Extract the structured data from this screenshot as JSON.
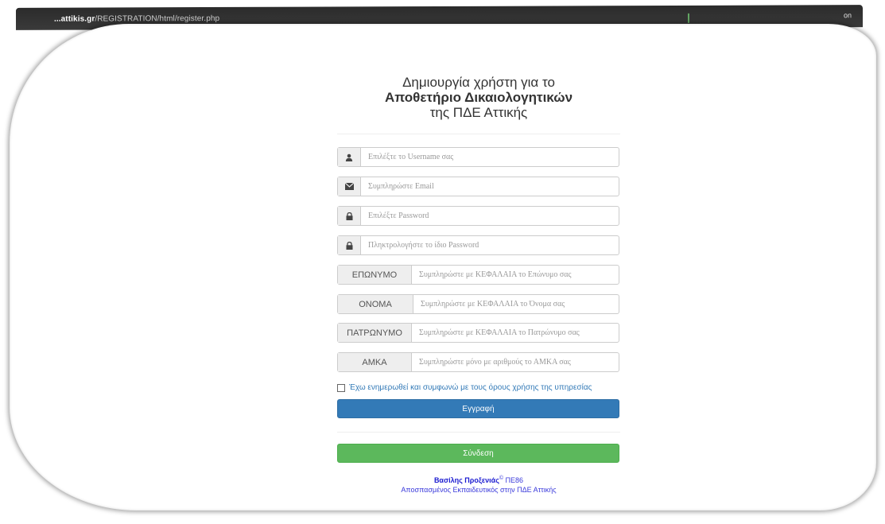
{
  "browser": {
    "url_host": "...attikis.gr",
    "url_path": "/REGISTRATION/html/register.php",
    "right_text": "on"
  },
  "heading": {
    "line1": "Δημιουργία χρήστη για το",
    "line2": "Αποθετήριο Δικαιολογητικών",
    "line3": "της ΠΔΕ Αττικής"
  },
  "fields": {
    "username": {
      "icon": "user-icon",
      "placeholder": "Επιλέξτε το Username σας"
    },
    "email": {
      "icon": "envelope-icon",
      "placeholder": "Συμπληρώστε Email"
    },
    "password": {
      "icon": "lock-icon",
      "placeholder": "Επιλέξτε Password"
    },
    "password_repeat": {
      "icon": "lock-icon",
      "placeholder": "Πληκτρολογήστε το ίδιο Password"
    },
    "surname": {
      "label": "ΕΠΩΝΥΜΟ",
      "placeholder": "Συμπληρώστε με ΚΕΦΑΛΑΙΑ το Επώνυμο σας"
    },
    "firstname": {
      "label": "ΟΝΟΜΑ",
      "placeholder": "Συμπληρώστε με ΚΕΦΑΛΑΙΑ το Όνομα σας"
    },
    "fathername": {
      "label": "ΠΑΤΡΩΝΥΜΟ",
      "placeholder": "Συμπληρώστε με ΚΕΦΑΛΑΙΑ το Πατρώνυμο σας"
    },
    "amka": {
      "label": "ΑΜΚΑ",
      "placeholder": "Συμπληρώστε μόνο με αριθμούς το ΑΜΚΑ σας"
    }
  },
  "terms_label": "Έχω ενημερωθεί και συμφωνώ με τους όρους χρήσης της υπηρεσίας",
  "buttons": {
    "register": "Εγγραφή",
    "login": "Σύνδεση"
  },
  "footer": {
    "author": "Βασίλης Προξενιάς",
    "copyright": "©",
    "role": " ΠΕ86",
    "line2": "Αποσπασμένος Εκπαιδευτικός στην ΠΔΕ Αττικής"
  },
  "colors": {
    "primary": "#337ab7",
    "success": "#5cb85c",
    "link": "#337ab7"
  }
}
